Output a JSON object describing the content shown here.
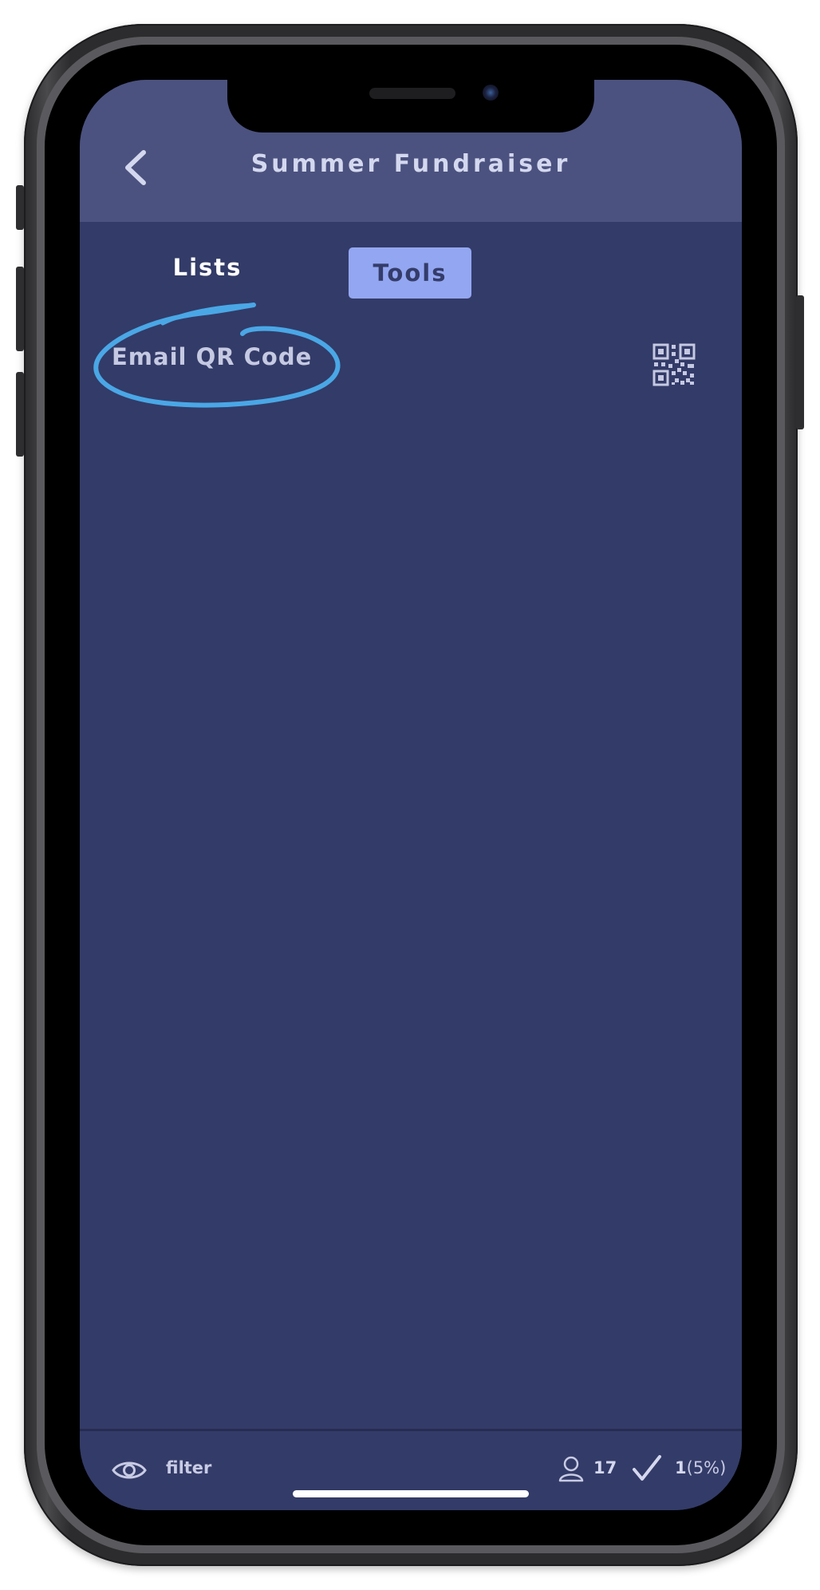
{
  "header": {
    "title": "Summer Fundraiser",
    "back_icon": "chevron-left-icon"
  },
  "tabs": [
    {
      "label": "Lists",
      "active": false
    },
    {
      "label": "Tools",
      "active": true
    }
  ],
  "tools": {
    "items": [
      {
        "label": "Email QR Code",
        "icon": "qr-code-icon"
      }
    ]
  },
  "footer": {
    "filter_label": "filter",
    "filter_icon": "eye-icon",
    "users_icon": "person-icon",
    "users_count": "17",
    "checked_icon": "check-icon",
    "checked_count": "1",
    "checked_percent": "(5%)"
  },
  "colors": {
    "header_bg": "#4b527f",
    "screen_bg": "#333b68",
    "active_tab_bg": "#93a6f1",
    "annotation": "#4aa7e6"
  }
}
